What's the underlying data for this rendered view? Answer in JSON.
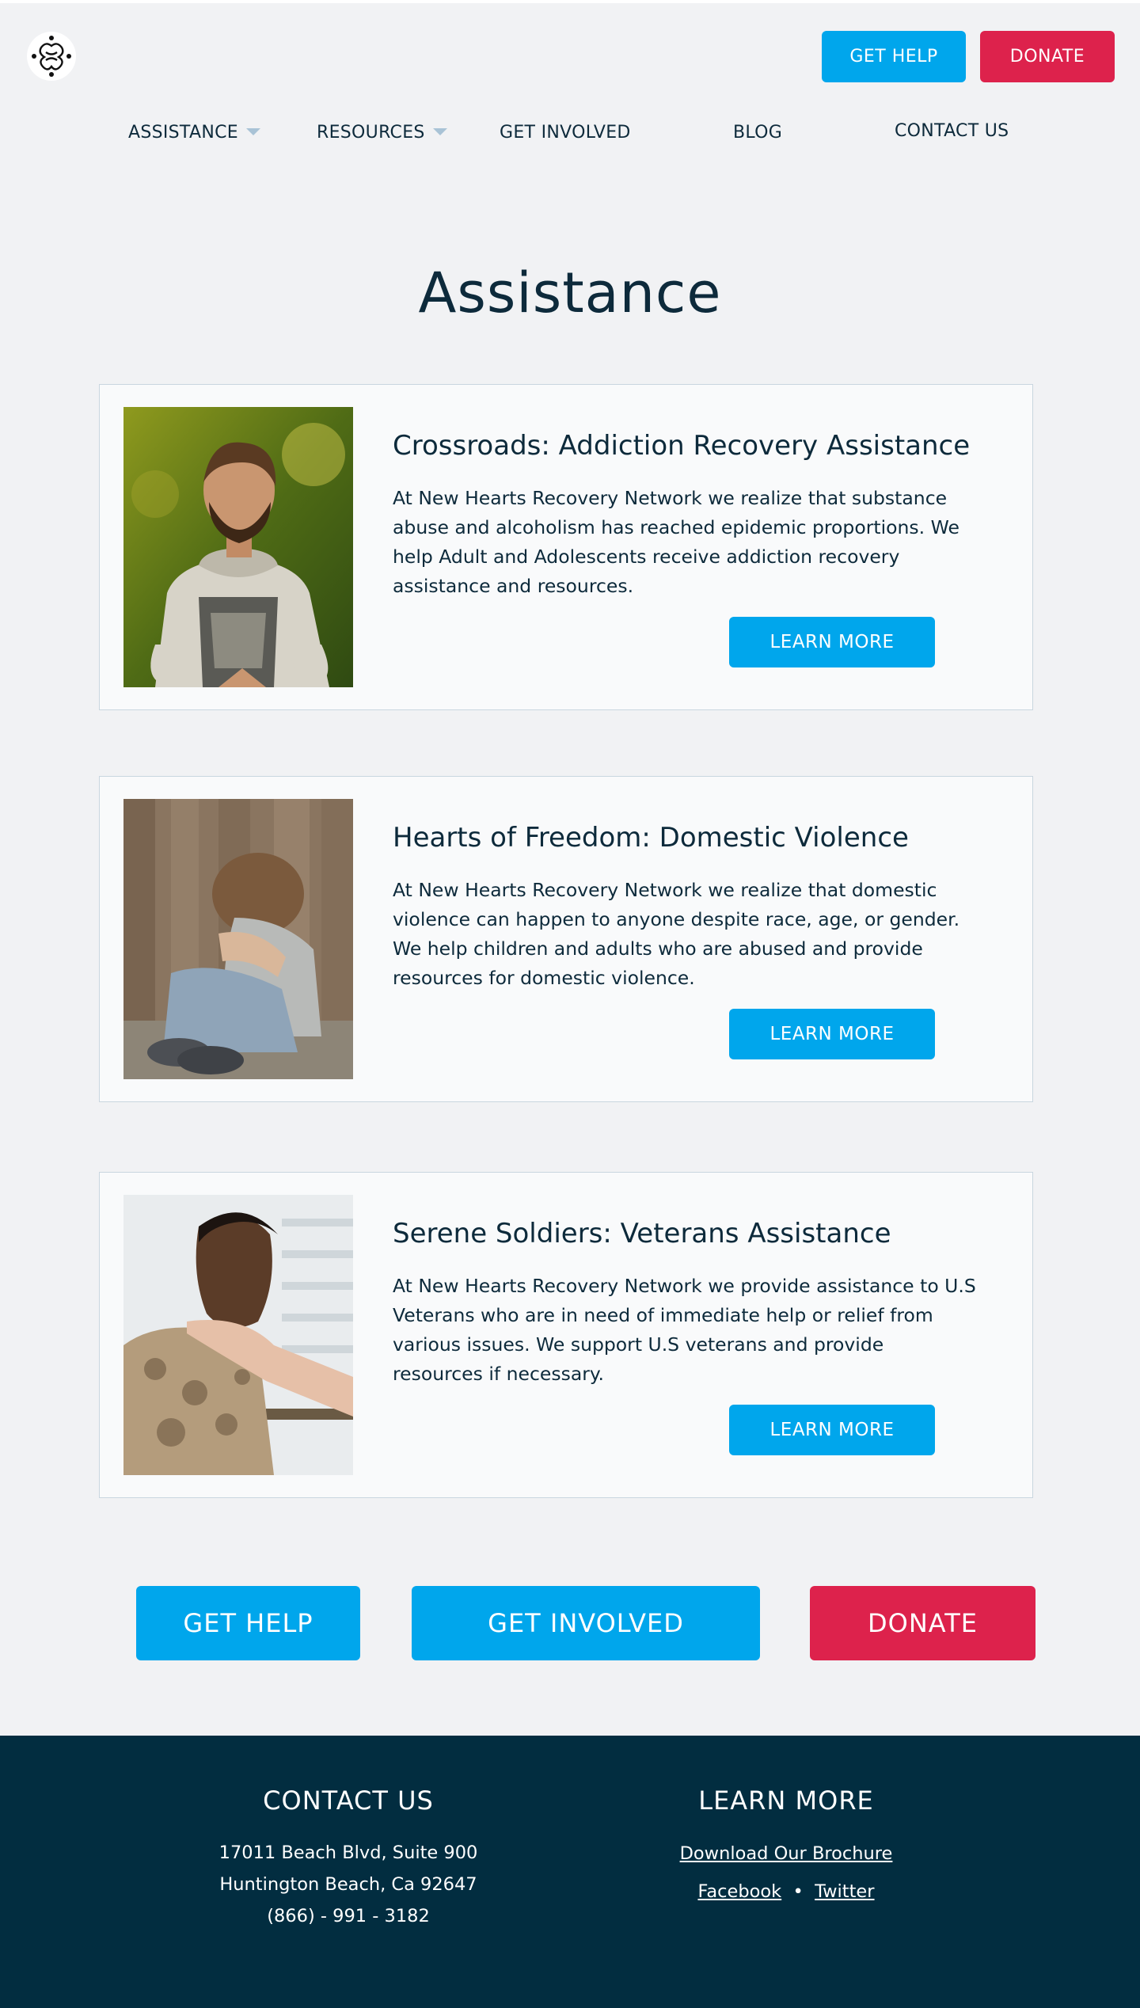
{
  "header": {
    "logo_name": "New Hearts Recovery Network logo",
    "get_help": "GET HELP",
    "donate": "DONATE"
  },
  "nav": {
    "items": [
      {
        "label": "ASSISTANCE",
        "dropdown": true
      },
      {
        "label": "RESOURCES",
        "dropdown": true
      },
      {
        "label": "GET INVOLVED",
        "dropdown": false
      },
      {
        "label": "BLOG",
        "dropdown": false
      },
      {
        "label": "CONTACT US",
        "dropdown": false
      }
    ]
  },
  "page": {
    "title": "Assistance"
  },
  "cards": [
    {
      "title": "Crossroads: Addiction Recovery Assistance",
      "text": "At New Hearts Recovery Network we realize that substance abuse and alcoholism has reached epidemic proportions. We help Adult and Adolescents receive addiction recovery assistance and resources.",
      "button": "LEARN MORE",
      "image": "meditating-man-photo"
    },
    {
      "title": "Hearts of Freedom: Domestic Violence",
      "text": "At New Hearts Recovery Network we realize that domestic violence can happen to anyone despite race, age, or gender. We help children and adults who are abused and provide resources for domestic violence.",
      "button": "LEARN MORE",
      "image": "crying-child-photo"
    },
    {
      "title": "Serene Soldiers: Veterans Assistance",
      "text": "At New Hearts Recovery Network we provide assistance to U.S Veterans who are in need of immediate help or relief from various issues. We support U.S veterans and provide resources if necessary.",
      "button": "LEARN MORE",
      "image": "soldier-comforted-photo"
    }
  ],
  "cta": {
    "get_help": "GET HELP",
    "get_involved": "GET INVOLVED",
    "donate": "DONATE"
  },
  "footer": {
    "contact": {
      "heading": "CONTACT US",
      "address1": "17011 Beach Blvd, Suite 900",
      "address2": "Huntington Beach, Ca 92647",
      "phone": "(866) - 991 - 3182"
    },
    "learn": {
      "heading": "LEARN MORE",
      "brochure": "Download Our Brochure",
      "facebook": "Facebook",
      "separator": "•",
      "twitter": "Twitter"
    }
  },
  "colors": {
    "accent_blue": "#00a6ec",
    "accent_red": "#dd224c",
    "navy": "#022d40",
    "background": "#f1f2f4"
  }
}
